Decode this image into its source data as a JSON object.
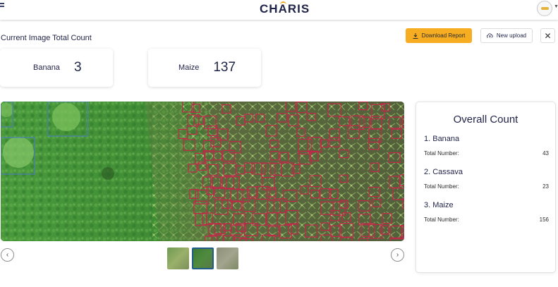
{
  "header": {
    "logo_text_1": "CH",
    "logo_text_2": "A",
    "logo_text_3": "RIS",
    "menu_icon": "hamburger-icon",
    "avatar_icon": "user-avatar-icon"
  },
  "toolbar": {
    "title": "Current Image Total Count",
    "download_label": "Download Report",
    "upload_label": "New upload",
    "close_glyph": "✕",
    "accent_color": "#f6ad21"
  },
  "current_counts": [
    {
      "label": "Banana",
      "value": "3"
    },
    {
      "label": "Maize",
      "value": "137"
    }
  ],
  "carousel": {
    "prev_glyph": "‹",
    "next_glyph": "›",
    "thumbnail_count": 3,
    "selected_index": 1
  },
  "overall": {
    "title": "Overall Count",
    "items": [
      {
        "name": "1. Banana",
        "row_label": "Total Number:",
        "value": "43"
      },
      {
        "name": "2. Cassava",
        "row_label": "Total Number:",
        "value": "23"
      },
      {
        "name": "3. Maize",
        "row_label": "Total Number:",
        "value": "156"
      }
    ]
  },
  "detections": {
    "banana_box_color": "#4a7fb5",
    "maize_box_color": "#c4264a"
  }
}
